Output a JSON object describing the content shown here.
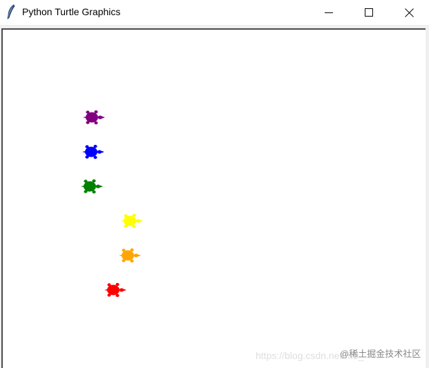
{
  "window": {
    "title": "Python Turtle Graphics",
    "app_icon": "feather-icon",
    "controls": {
      "minimize_icon": "minimize-icon",
      "maximize_icon": "maximize-icon",
      "close_icon": "close-icon"
    }
  },
  "canvas": {
    "background": "#ffffff",
    "turtles": [
      {
        "name": "turtle-purple",
        "color": "#800080"
      },
      {
        "name": "turtle-blue",
        "color": "#0000ff"
      },
      {
        "name": "turtle-green",
        "color": "#008000"
      },
      {
        "name": "turtle-yellow",
        "color": "#ffff00"
      },
      {
        "name": "turtle-orange",
        "color": "#ffa500"
      },
      {
        "name": "turtle-red",
        "color": "#ff0000"
      }
    ]
  },
  "watermark": {
    "url": "https://blog.csdn.net/m0_",
    "brand": "@稀土掘金技术社区"
  }
}
